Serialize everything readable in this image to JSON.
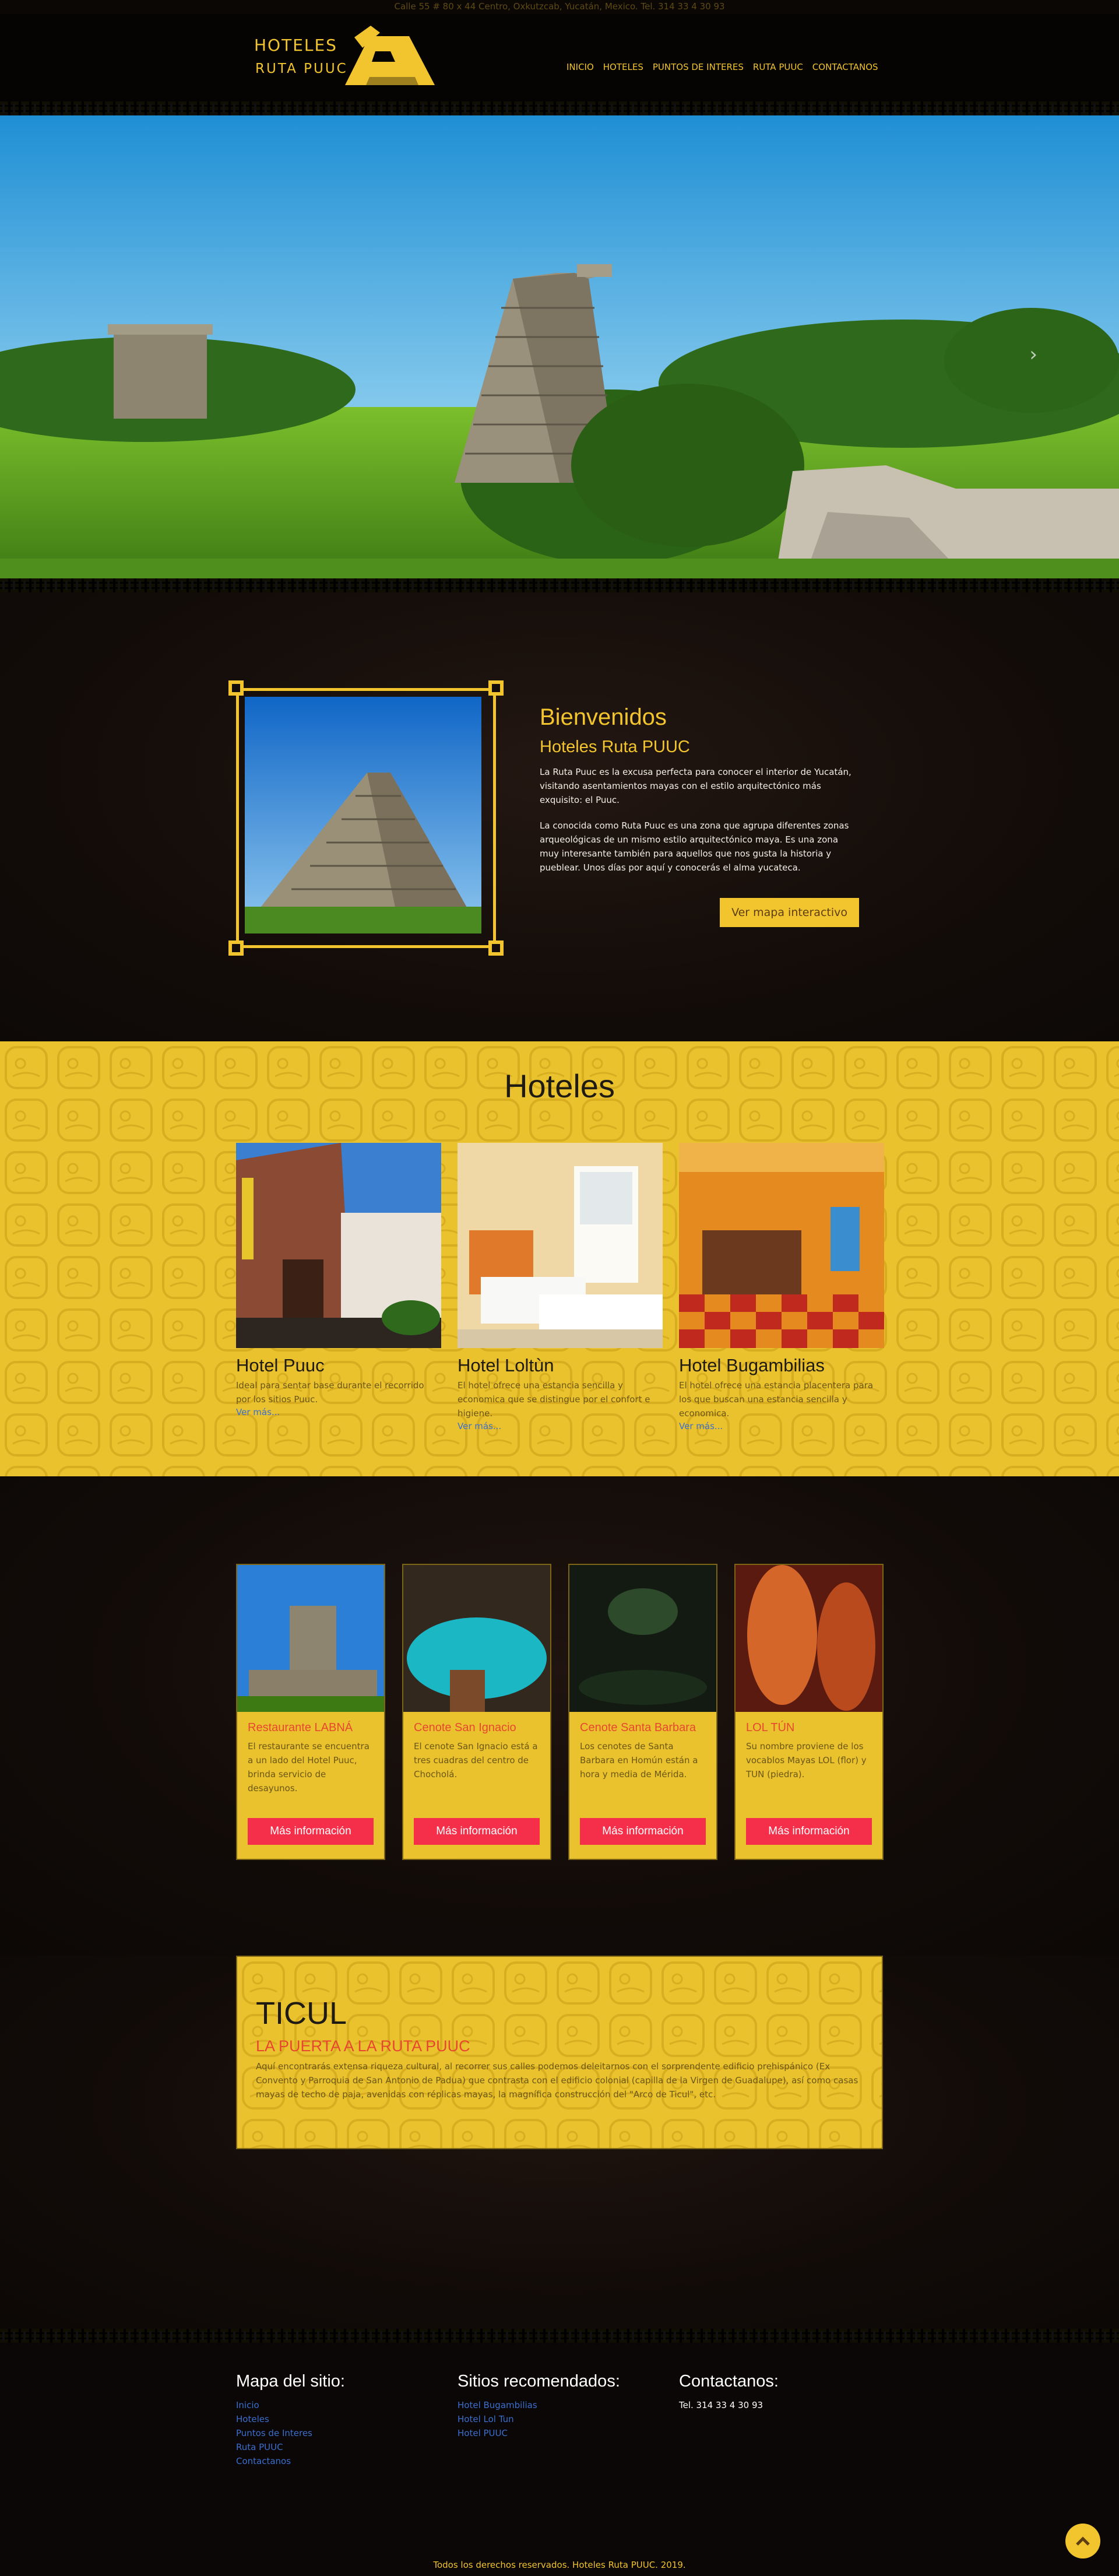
{
  "topbar": {
    "address": "Calle 55 # 80 x 44 Centro, Oxkutzcab, Yucatán, Mexico. Tel. 314 33 4 30 93"
  },
  "logo": {
    "line1": "HOTELES",
    "line2": "RUTA PUUC"
  },
  "nav": [
    "INICIO",
    "HOTELES",
    "PUNTOS DE INTERES",
    "RUTA PUUC",
    "CONTACTANOS"
  ],
  "welcome": {
    "title": "Bienvenidos",
    "subtitle": "Hoteles Ruta PUUC",
    "p1": "La Ruta Puuc es la excusa perfecta para conocer el interior de Yucatán, visitando asentamientos mayas con el estilo arquitectónico más exquisito: el Puuc.",
    "p2": "La conocida como Ruta Puuc es una zona que agrupa diferentes zonas arqueológicas de un mismo estilo arquitectónico maya. Es una zona muy interesante también para aquellos que nos gusta la historia y pueblear. Unos días por aquí y conocerás el alma yucateca.",
    "button": "Ver mapa interactivo"
  },
  "hoteles": {
    "title": "Hoteles",
    "cards": [
      {
        "name": "Hotel Puuc",
        "desc": "Ideal para sentar base durante el recorrido por los sitios Puuc.",
        "link": "Ver más..."
      },
      {
        "name": "Hotel Loltùn",
        "desc": "El hotel ofrece una estancia sencilla y economica que se distingue por el confort e higiene.",
        "link": "Ver más..."
      },
      {
        "name": "Hotel Bugambilias",
        "desc": "El hotel ofrece una estancia placentera para los que buscan una estancia sencilla y economica.",
        "link": "Ver más..."
      }
    ]
  },
  "attractions": [
    {
      "title": "Restaurante LABNÁ",
      "desc": "El restaurante se encuentra a un lado del Hotel Puuc, brinda servicio de desayunos.",
      "button": "Más información"
    },
    {
      "title": "Cenote San Ignacio",
      "desc": "El cenote San Ignacio está a tres cuadras del centro de Chocholá.",
      "button": "Más información"
    },
    {
      "title": "Cenote Santa Barbara",
      "desc": "Los cenotes de Santa Barbara en Homún están a hora y media de Mérida.",
      "button": "Más información"
    },
    {
      "title": "LOL TÚN",
      "desc": "Su nombre proviene de los vocablos Mayas LOL (flor) y TUN (piedra).",
      "button": "Más información"
    }
  ],
  "ticul": {
    "title": "TICUL",
    "subtitle": "LA PUERTA A LA RUTA PUUC",
    "text": "Aquí encontrarás extensa riqueza cultural, al recorrer sus calles podemos deleitarnos con el sorprendente edificio prehispánico (Ex Convento y Parroquia de San Antonio de Padua) que contrasta con el edificio colonial (capilla de la Virgen de Guadalupe), así como casas mayas de techo de paja, avenidas con réplicas mayas, la magnífica construcción del \"Arco de Ticul\", etc."
  },
  "footer": {
    "sitemap": {
      "title": "Mapa del sitio:",
      "links": [
        "Inicio",
        "Hoteles",
        "Puntos de Interes",
        "Ruta PUUC",
        "Contactanos"
      ]
    },
    "recommended": {
      "title": "Sitios recomendados:",
      "links": [
        "Hotel Bugambilias",
        "Hotel Lol Tun",
        "Hotel PUUC"
      ]
    },
    "contact": {
      "title": "Contactanos:",
      "phone": "Tel. 314 33 4 30 93"
    },
    "copyright": "Todos los derechos reservados. Hoteles Ruta PUUC. 2019."
  },
  "colors": {
    "accent": "#f2c42d",
    "red": "#f52f49",
    "link": "#3b6fcf",
    "background": "#0d0907"
  },
  "icons": {
    "next": "chevron-right-icon",
    "back_to_top": "chevron-up-icon"
  }
}
